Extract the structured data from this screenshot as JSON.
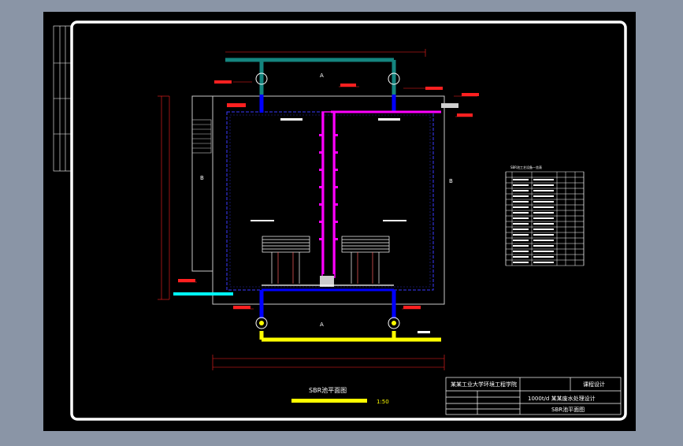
{
  "drawing": {
    "title": "SBR池平面图",
    "scale": "1:50",
    "section_labels": [
      "A",
      "A",
      "B",
      "B"
    ],
    "title_block": {
      "school": "某某工业大学环境工程学院",
      "course": "课程设计",
      "project": "1000t/d 某某废水处理设计",
      "sheet": "SBR池平面图"
    },
    "equipment_table": {
      "title": "SBR池工艺设备一览表",
      "rows": 16
    }
  },
  "colors": {
    "background": "#000000",
    "frame": "#ffffff",
    "inlet_pipe": "#15857f",
    "outlet_pipe": "#ffff00",
    "air_pipe": "#ff00ff",
    "sludge_pipe": "#0000ff",
    "drain_pipe": "#00ffff",
    "dimension": "#ff0000"
  }
}
